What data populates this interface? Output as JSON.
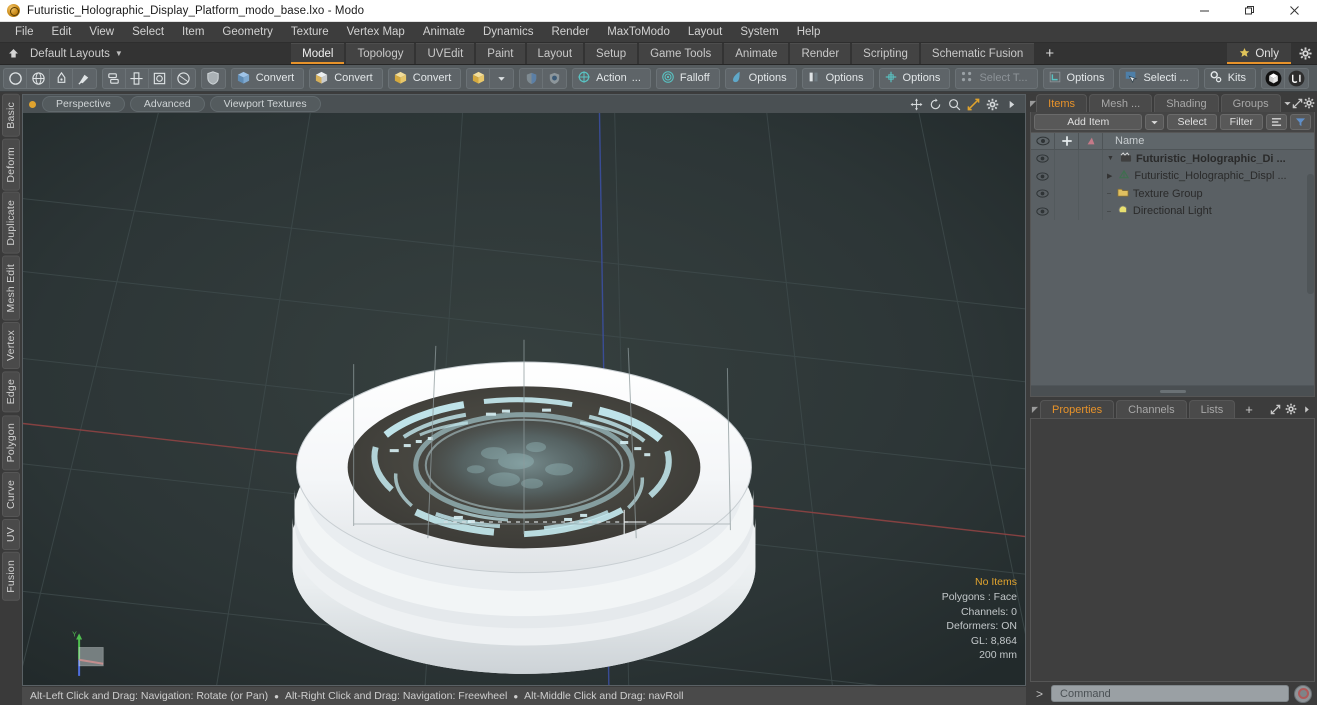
{
  "window": {
    "title": "Futuristic_Holographic_Display_Platform_modo_base.lxo - Modo",
    "app_icon": "modo-app-icon",
    "minimize": "minimize-icon",
    "maximize": "maximize-icon",
    "close": "close-icon"
  },
  "menubar": {
    "items": [
      "File",
      "Edit",
      "View",
      "Select",
      "Item",
      "Geometry",
      "Texture",
      "Vertex Map",
      "Animate",
      "Dynamics",
      "Render",
      "MaxToModo",
      "Layout",
      "System",
      "Help"
    ]
  },
  "layoutbar": {
    "home_icon": "home-icon",
    "layouts_label": "Default Layouts",
    "tabs": [
      {
        "label": "Model",
        "active": true
      },
      {
        "label": "Topology",
        "active": false
      },
      {
        "label": "UVEdit",
        "active": false
      },
      {
        "label": "Paint",
        "active": false
      },
      {
        "label": "Layout",
        "active": false
      },
      {
        "label": "Setup",
        "active": false
      },
      {
        "label": "Game Tools",
        "active": false
      },
      {
        "label": "Animate",
        "active": false
      },
      {
        "label": "Render",
        "active": false
      },
      {
        "label": "Scripting",
        "active": false
      },
      {
        "label": "Schematic Fusion",
        "active": false
      }
    ],
    "add_tab": "+",
    "only_label": "Only",
    "only_icon": "star-icon",
    "gear_icon": "gear-icon"
  },
  "toolbar": {
    "group1": [
      "circle-icon",
      "globe-icon",
      "pen-icon",
      "brush-icon"
    ],
    "group2": [
      "stack-icon",
      "mirror-icon",
      "square-target-icon",
      "ellipse-icon"
    ],
    "group3": [
      "shield-icon"
    ],
    "convert1": "Convert",
    "convert2": "Convert",
    "convert3": "Convert",
    "dropdown_icon": "chevron-down-icon",
    "action_label": "Action",
    "action_suffix": "...",
    "falloff_label": "Falloff",
    "options1_label": "Options",
    "options2_label": "Options",
    "options3_label": "Options",
    "select_t_label": "Select T...",
    "options4_label": "Options",
    "selection_label": "Selecti ...",
    "kits_label": "Kits",
    "end_icon1": "cube-badge-icon",
    "end_icon2": "unity-icon"
  },
  "vtabs": {
    "items": [
      "Basic",
      "Deform",
      "Duplicate",
      "Mesh Edit",
      "Vertex",
      "Edge",
      "Polygon",
      "Curve",
      "UV",
      "Fusion"
    ]
  },
  "viewport": {
    "dot": "active-indicator",
    "buttons": [
      "Perspective",
      "Advanced",
      "Viewport Textures"
    ],
    "icons": [
      "move-icon",
      "rotate-icon",
      "zoom-icon",
      "fit-icon",
      "gear-icon",
      "play-icon"
    ],
    "info": {
      "no_items": "No Items",
      "polygons": "Polygons : Face",
      "channels": "Channels: 0",
      "deformers": "Deformers: ON",
      "gl": "GL: 8,864",
      "scale": "200 mm"
    },
    "axis_gizmo": "axis-gizmo"
  },
  "statusbar": {
    "hint1": "Alt-Left Click and Drag: Navigation: Rotate (or Pan)",
    "hint2": "Alt-Right Click and Drag: Navigation: Freewheel",
    "hint3": "Alt-Middle Click and Drag: navRoll"
  },
  "right_panel": {
    "tabs": [
      {
        "label": "Items",
        "active": true
      },
      {
        "label": "Mesh ...",
        "active": false
      },
      {
        "label": "Shading",
        "active": false
      },
      {
        "label": "Groups",
        "active": false
      }
    ],
    "tab_icons": [
      "chevron-down-icon",
      "expand-icon",
      "gear-icon",
      "chevron-right-icon"
    ],
    "add_item_label": "Add Item",
    "add_item_caret": "chevron-down-icon",
    "select_label": "Select",
    "filter_label": "Filter",
    "list_icon": "list-icon",
    "funnel_icon": "funnel-icon",
    "list_header": {
      "eye": "eye-icon",
      "col2": "move-icon",
      "col3": "shade-icon",
      "name": "Name"
    },
    "items": [
      {
        "label": "Futuristic_Holographic_Di ...",
        "icon": "scene-icon",
        "indent": 0,
        "bold": true,
        "expander": "triangle-down"
      },
      {
        "label": "Futuristic_Holographic_Displ ...",
        "icon": "mesh-icon",
        "indent": 1,
        "bold": false,
        "expander": "triangle-right"
      },
      {
        "label": "Texture Group",
        "icon": "folder-icon",
        "indent": 1,
        "bold": false,
        "expander": "dash"
      },
      {
        "label": "Directional Light",
        "icon": "light-icon",
        "indent": 1,
        "bold": false,
        "expander": "dash"
      }
    ],
    "prop_tabs": [
      {
        "label": "Properties",
        "active": true
      },
      {
        "label": "Channels",
        "active": false
      },
      {
        "label": "Lists",
        "active": false
      }
    ],
    "prop_add": "+"
  },
  "command": {
    "prompt": ">",
    "placeholder": "Command",
    "record_icon": "record-icon"
  },
  "colors": {
    "accent": "#e8932a",
    "toolbar_bg": "#555b5e",
    "panel_bg": "#3c3c3c",
    "viewport_bg": "#2a3133",
    "list_bg": "#5a6064",
    "hologram": "#b8e8ef"
  }
}
